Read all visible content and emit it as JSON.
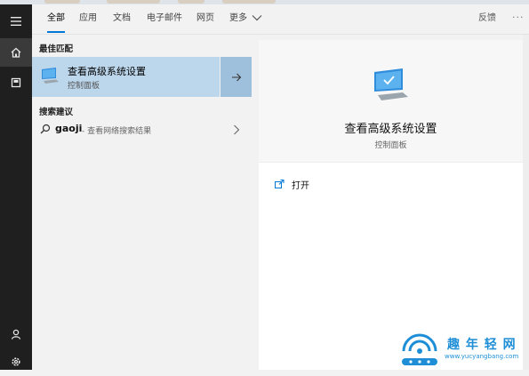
{
  "tabs": {
    "items": [
      {
        "label": "全部",
        "active": true
      },
      {
        "label": "应用"
      },
      {
        "label": "文档"
      },
      {
        "label": "电子邮件"
      },
      {
        "label": "网页"
      },
      {
        "label": "更多"
      }
    ],
    "feedback_label": "反馈",
    "overflow_label": "···"
  },
  "sidebar": {
    "icons": [
      "hamburger-menu-icon",
      "home-icon",
      "documents-icon",
      "user-icon",
      "settings-gear-icon"
    ],
    "active": "home-icon"
  },
  "results": {
    "best_match_heading": "最佳匹配",
    "best_match": {
      "title": "查看高级系统设置",
      "subtitle": "控制面板"
    },
    "suggestions_heading": "搜索建议",
    "suggestion": {
      "query": "gaoji",
      "description": "- 查看网络搜索结果"
    }
  },
  "preview": {
    "title": "查看高级系统设置",
    "subtitle": "控制面板",
    "actions": [
      {
        "label": "打开",
        "icon": "open-icon"
      }
    ]
  },
  "watermark": {
    "name": "趣 年 轻 网",
    "url": "www.yucyangbang.com"
  },
  "colors": {
    "accent": "#0078d7",
    "selected_row": "#bcd6ec",
    "selected_arrow": "#9fc0dd",
    "rail": "#1f1f1f",
    "watermark": "#1e8fd6"
  }
}
